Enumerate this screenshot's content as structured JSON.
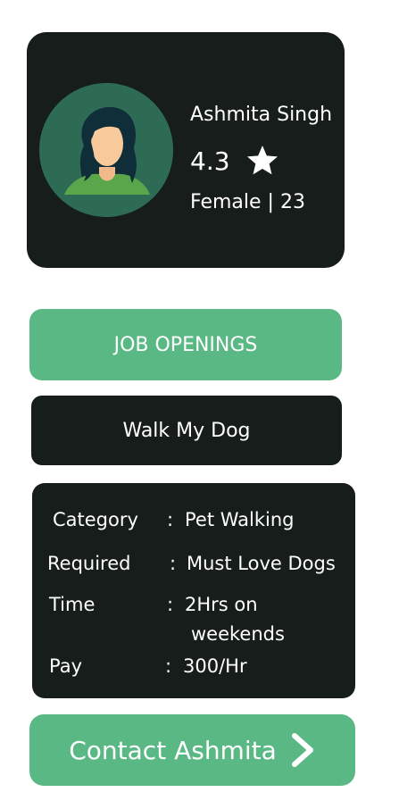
{
  "profile": {
    "name": "Ashmita Singh",
    "rating": "4.3",
    "demographics": "Female | 23"
  },
  "job_openings_label": "JOB OPENINGS",
  "job_title": "Walk My Dog",
  "details": {
    "category_label": "Category",
    "category_value": "Pet Walking",
    "required_label": "Required",
    "required_value": "Must Love Dogs",
    "time_label": "Time",
    "time_value_line1": "2Hrs on",
    "time_value_line2": "weekends",
    "pay_label": "Pay",
    "pay_value": "300/Hr",
    "separator": ":"
  },
  "contact_label": "Contact Ashmita",
  "icons": {
    "avatar": "woman-avatar-icon",
    "star": "star-icon",
    "chevron": "chevron-right-icon"
  },
  "colors": {
    "dark_card": "#161d1a",
    "accent_green": "#5ab884",
    "avatar_bg": "#2e6b55"
  }
}
